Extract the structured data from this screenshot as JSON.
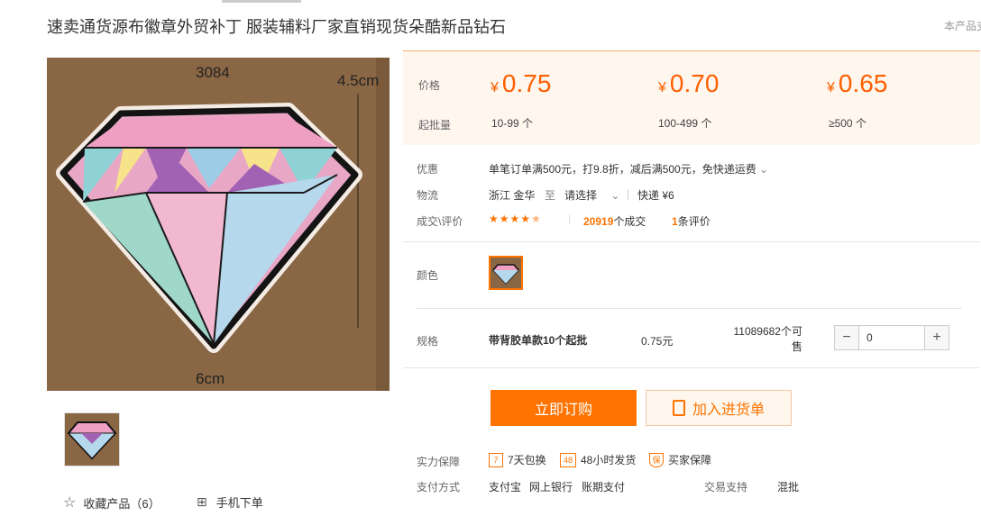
{
  "title": "速卖通货源布徽章外贸补丁 服装辅料厂家直销现货朵酷新品钻石",
  "title_right": "本产品支",
  "image": {
    "code": "3084",
    "height_label": "4.5cm",
    "width_label": "6cm"
  },
  "actions": {
    "favorite": "收藏产品（6）",
    "mobile_order": "手机下单"
  },
  "pricing": {
    "price_label": "价格",
    "qty_label": "起批量",
    "currency": "¥",
    "tiers": [
      {
        "price": "0.75",
        "range": "10-99 个"
      },
      {
        "price": "0.70",
        "range": "100-499 个"
      },
      {
        "price": "0.65",
        "range": "≥500 个"
      }
    ]
  },
  "promo": {
    "label": "优惠",
    "text": "单笔订单满500元，打9.8折，减后满500元，免快递运费"
  },
  "logistics": {
    "label": "物流",
    "origin": "浙江 金华",
    "to": "至",
    "select": "请选择",
    "express": "快递 ¥6"
  },
  "rating": {
    "label": "成交\\评价",
    "stars": "★★★★",
    "half_star": "★",
    "deals_count": "20919",
    "deals_suffix": "个成交",
    "review_count": "1",
    "review_suffix": "条评价"
  },
  "color": {
    "label": "颜色"
  },
  "spec": {
    "label": "规格",
    "name": "带背胶单款10个起批",
    "price": "0.75元",
    "stock_line1": "11089682个可",
    "stock_line2": "售",
    "quantity": "0",
    "minus": "−",
    "plus": "+"
  },
  "buttons": {
    "buy": "立即订购",
    "cart": "加入进货单"
  },
  "guarantee": {
    "label": "实力保障",
    "items": [
      {
        "icon": "7",
        "text": "7天包换"
      },
      {
        "icon": "48",
        "text": "48小时发货"
      },
      {
        "icon": "保",
        "text": "买家保障"
      }
    ]
  },
  "payment": {
    "label": "支付方式",
    "methods": [
      "支付宝",
      "网上银行",
      "账期支付"
    ],
    "trade_label": "交易支持",
    "trade_value": "混批"
  },
  "colors": {
    "accent": "#ff7300",
    "price": "#ff5f00",
    "price_bg": "#fff6ee"
  }
}
